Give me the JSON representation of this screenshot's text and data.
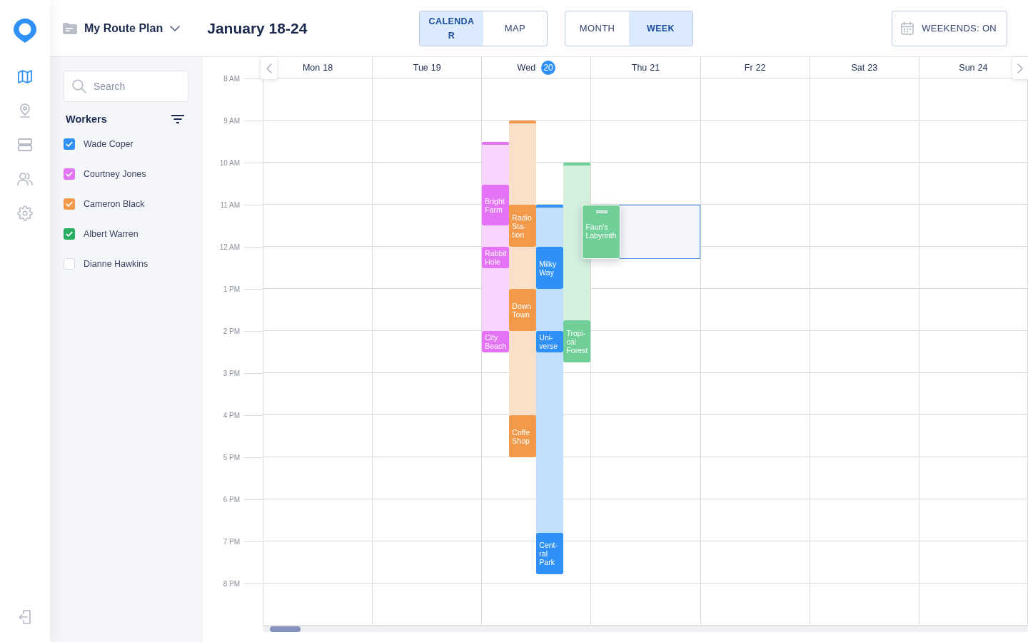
{
  "rail": {
    "nav_items": [
      {
        "selected": true
      },
      {
        "selected": false
      },
      {
        "selected": false
      },
      {
        "selected": false
      },
      {
        "selected": false
      }
    ]
  },
  "header": {
    "plan_menu": "My Route Plan",
    "title": "January 18-24",
    "view_tabs": [
      {
        "label": "CALENDAR",
        "selected": true
      },
      {
        "label": "MAP",
        "selected": false
      }
    ],
    "range_tabs": [
      {
        "label": "MONTH",
        "selected": false
      },
      {
        "label": "WEEK",
        "selected": true
      }
    ],
    "weekends_button": "WEEKENDS: ON"
  },
  "sidebar": {
    "search": {
      "placeholder": "Search"
    },
    "workers_title": "Workers",
    "workers": [
      {
        "name": "Wade Coper",
        "checked": true,
        "color": "#2f91f7"
      },
      {
        "name": "Courtney Jones",
        "checked": true,
        "color": "#e573f5"
      },
      {
        "name": "Cameron Black",
        "checked": true,
        "color": "#f2994a"
      },
      {
        "name": "Albert Warren",
        "checked": true,
        "color": "#27ae60"
      },
      {
        "name": "Dianne Hawkins",
        "checked": false
      }
    ]
  },
  "calendar": {
    "hours": [
      "8 AM",
      "9 AM",
      "10 AM",
      "11 AM",
      "12 AM",
      "1 PM",
      "2 PM",
      "3 PM",
      "4 PM",
      "5 PM",
      "6 PM",
      "7 PM",
      "8 PM"
    ],
    "days": [
      {
        "weekday": "Mon",
        "date": "18",
        "today": false
      },
      {
        "weekday": "Tue",
        "date": "19",
        "today": false
      },
      {
        "weekday": "Wed",
        "date": "20",
        "today": true,
        "routes": [
          {
            "color": "#e573f5",
            "stops": [
              {
                "label": "Bright Farm"
              },
              {
                "label": "Rabbit Hole"
              },
              {
                "label": "City Beach"
              }
            ]
          },
          {
            "color": "#f2994a",
            "stops": [
              {
                "label": "Radio Sta-tion"
              },
              {
                "label": "Down Town"
              },
              {
                "label": "Coffe Shop"
              }
            ]
          },
          {
            "color": "#2f91f7",
            "stops": [
              {
                "label": "Milky Way"
              },
              {
                "label": "Uni-verse"
              },
              {
                "label": "Cent-ral Park"
              }
            ]
          },
          {
            "color": "#6fcf97",
            "stops": [
              {
                "label": "Tropi-cal Forest"
              }
            ]
          }
        ]
      },
      {
        "weekday": "Thu",
        "date": "21",
        "today": false,
        "dragged_stop": {
          "label": "Faun's Labyrinth",
          "color": "#6fcf97"
        }
      },
      {
        "weekday": "Fr",
        "date": "22",
        "today": false
      },
      {
        "weekday": "Sat",
        "date": "23",
        "today": false
      },
      {
        "weekday": "Sun",
        "date": "24",
        "today": false
      }
    ]
  }
}
